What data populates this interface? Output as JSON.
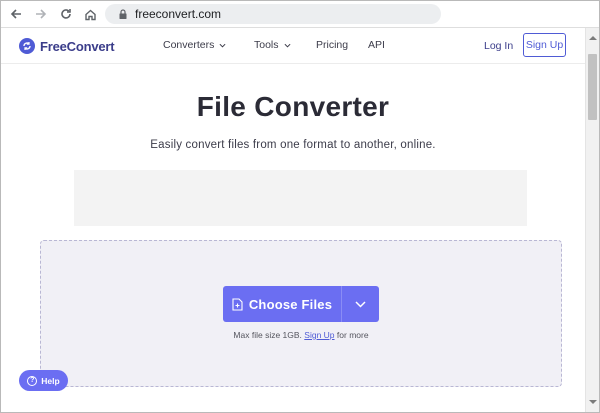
{
  "browser": {
    "url": "freeconvert.com"
  },
  "header": {
    "brand": "FreeConvert",
    "menu": [
      {
        "label": "Converters",
        "has_dropdown": true
      },
      {
        "label": "Tools",
        "has_dropdown": true
      },
      {
        "label": "Pricing",
        "has_dropdown": false
      },
      {
        "label": "API",
        "has_dropdown": false
      }
    ],
    "login_label": "Log In",
    "signup_label": "Sign Up"
  },
  "main": {
    "title": "File Converter",
    "subtitle": "Easily convert files from one format to another, online.",
    "choose_files_label": "Choose Files",
    "max_size_prefix": "Max file size 1GB.",
    "max_size_link": "Sign Up",
    "max_size_suffix": "for more"
  },
  "help": {
    "label": "Help"
  },
  "icons": {
    "back": "arrow-left-icon",
    "forward": "arrow-right-icon",
    "reload": "reload-icon",
    "home": "home-icon",
    "lock": "lock-icon",
    "logo": "freeconvert-logo-icon",
    "file_add": "file-plus-icon",
    "dropdown": "chevron-down-icon",
    "help": "question-circle-icon"
  },
  "colors": {
    "accent": "#6b6ef2",
    "brand": "#3b3d8a",
    "drop_zone_bg": "#f1f0f6"
  }
}
